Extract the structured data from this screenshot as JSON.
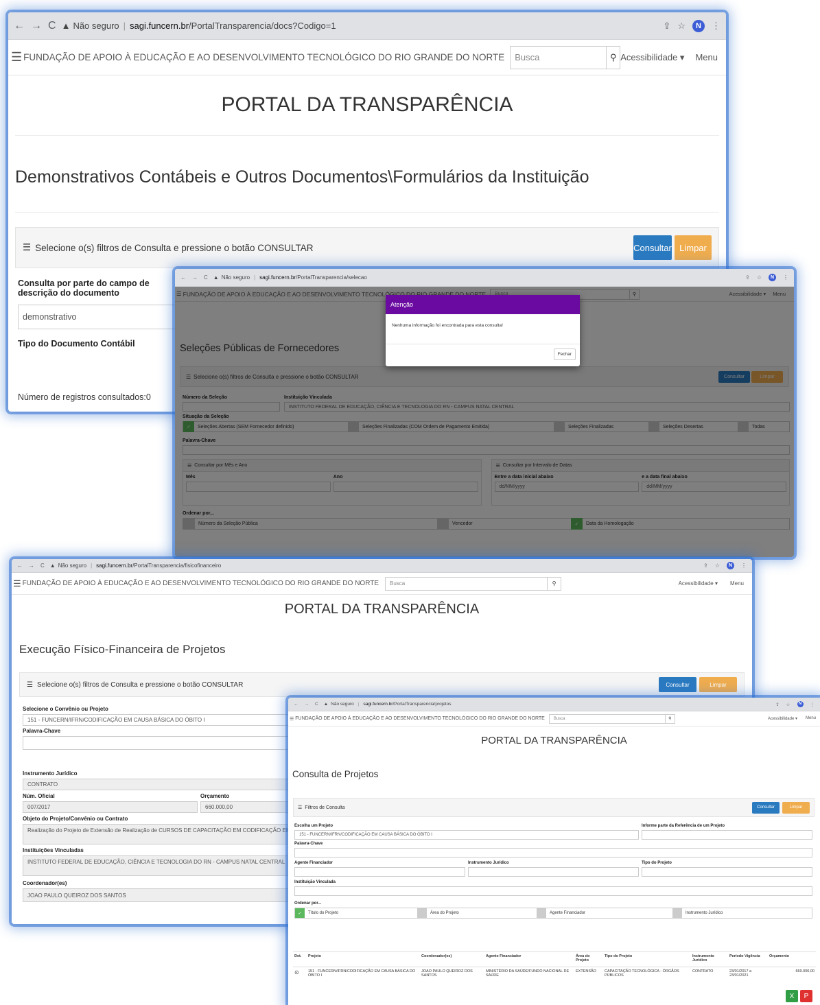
{
  "colors": {
    "blue": "#2a7ac0",
    "orange": "#f0ad4e",
    "purple": "#6a0aa0",
    "green": "#5cb85c",
    "highlight": "#2f6fcf"
  },
  "header": {
    "org": "FUNDAÇÃO DE APOIO À EDUCAÇÃO E AO DESENVOLVIMENTO TECNOLÓGICO DO RIO GRANDE DO NORTE",
    "search_placeholder": "Busca",
    "accessibility": "Acessibilidade ▾",
    "menu": "Menu",
    "portal_title": "PORTAL DA TRANSPARÊNCIA",
    "url_warning": "Não seguro",
    "avatar": "N"
  },
  "s1": {
    "url_host": "sagi.funcern.br",
    "url_path": "/PortalTransparencia/docs?Codigo=1",
    "title": "Demonstrativos Contábeis e Outros Documentos\\Formulários da Instituição",
    "panel_text": "Selecione o(s) filtros de Consulta e pressione o botão CONSULTAR",
    "consultar": "Consultar",
    "limpar": "Limpar",
    "field1_label": "Consulta por parte do campo de descrição do documento",
    "field1_value": "demonstrativo",
    "field2_label": "Tipo do Documento Contábil",
    "records": "Número de registros consultados:0"
  },
  "s2": {
    "url_host": "sagi.funcern.br",
    "url_path": "/PortalTransparencia/selecao",
    "title": "Seleções Públicas de Fornecedores",
    "modal_title": "Atenção",
    "modal_body": "Nenhuma informação foi encontrada para esta consulta!",
    "modal_close": "Fechar",
    "panel_text": "Selecione o(s) filtros de Consulta e pressione o botão CONSULTAR",
    "consultar": "Consultar",
    "limpar": "Limpar",
    "num_selecao": "Número da Seleção",
    "instituicao_label": "Instituição Vinculada",
    "instituicao_value": "INSTITUTO FEDERAL DE EDUCAÇÃO, CIÊNCIA E TECNOLOGIA DO RN - CAMPUS NATAL CENTRAL",
    "situacao_label": "Situação da Seleção",
    "situacao": [
      "Seleções Abertas (SEM Fornecedor definido)",
      "Seleções Finalizadas (COM Ordem de Pagamento Emitida)",
      "Seleções Finalizadas",
      "Seleções Desertas",
      "Todas"
    ],
    "palavra": "Palavra-Chave",
    "mes_ano": "Consultar por Mês e Ano",
    "intervalo": "Consultar por Intervalo de Datas",
    "mes": "Mês",
    "ano": "Ano",
    "data_ini": "Entre a data inicial abaixo",
    "data_fim": "e a data final abaixo",
    "date_ph": "dd/MM/yyyy",
    "ordenar": "Ordenar por...",
    "ord": [
      "Número da Seleção Pública",
      "Vencedor",
      "Data da Homologação"
    ]
  },
  "s3": {
    "url_host": "sagi.funcern.br",
    "url_path": "/PortalTransparencia/fisicofinanceiro",
    "title": "Execução Físico-Financeira de Projetos",
    "panel_text": "Selecione o(s) filtros de Consulta e pressione o botão CONSULTAR",
    "consultar": "Consultar",
    "limpar": "Limpar",
    "convenio_label": "Selecione o Convênio ou Projeto",
    "convenio_value": "151 - FUNCERN/IFRN/CODIFICAÇÃO EM CAUSA BÁSICA DO ÓBITO I",
    "palavra": "Palavra-Chave",
    "instrumento_label": "Instrumento Jurídico",
    "instrumento_value": "CONTRATO",
    "num_label": "Núm. Oficial",
    "num_value": "007/2017",
    "orc_label": "Orçamento",
    "orc_value": "660.000,00",
    "objeto_label": "Objeto do Projeto/Convênio ou Contrato",
    "objeto_value": "Realização do Projeto de Extensão de Realização de CURSOS DE CAPACITAÇÃO EM CODIFICAÇÃO EM",
    "inst_label": "Instituições Vinculadas",
    "inst_value": "INSTITUTO FEDERAL DE EDUCAÇÃO, CIÊNCIA E TECNOLOGIA DO RN - CAMPUS NATAL CENTRAL",
    "coord_label": "Coordenador(es)",
    "coord_value": "JOAO PAULO QUEIROZ DOS SANTOS"
  },
  "s4": {
    "url_host": "sagi.funcern.br",
    "url_path": "/PortalTransparencia/projetos",
    "title": "Consulta de Projetos",
    "panel_text": "Filtros de Consulta",
    "consultar": "Consultar",
    "limpar": "Limpar",
    "escolha_label": "Escolha um Projeto",
    "escolha_value": "151 - FUNCERN/IFRN/CODIFICAÇÃO EM CAUSA BÁSICA DO ÓBITO I",
    "ref_label": "Informe parte da Referência de um Projeto",
    "palavra": "Palavra-Chave",
    "agente": "Agente Financiador",
    "instrumento": "Instrumento Jurídico",
    "tipo": "Tipo do Projeto",
    "instituicao": "Instituição Vinculada",
    "ordenar": "Ordenar por...",
    "ord": [
      "Título do Projeto",
      "Área do Projeto",
      "Agente Financiador",
      "Instrumento Jurídico"
    ],
    "table": {
      "headers": [
        "Det.",
        "Projeto",
        "Coordenador(es)",
        "Agente Financiador",
        "Área do Projeto",
        "Tipo do Projeto",
        "Instrumento Jurídico",
        "Período Vigência",
        "Orçamento"
      ],
      "row": [
        "",
        "151 - FUNCERN/IFRN/CODIFICAÇÃO EM CAUSA BÁSICA DO ÓBITO I",
        "JOAO PAULO QUEIROZ DOS SANTOS",
        "MINISTÉRIO DA SAÚDE/FUNDO NACIONAL DE SAÚDE",
        "EXTENSÃO",
        "CAPACITAÇÃO TECNOLÓGICA - ÓRGÃOS PÚBLICOS",
        "CONTRATO",
        "23/01/2017 a 23/01/2021",
        "660.000,00"
      ]
    }
  }
}
